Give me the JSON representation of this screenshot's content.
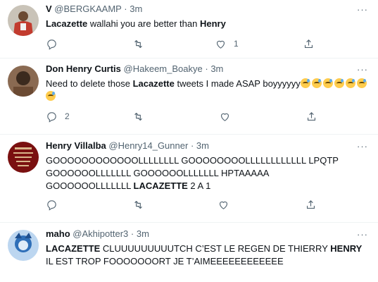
{
  "tweets": [
    {
      "name": "V",
      "handle": "@BERGKAAMP",
      "time": "3m",
      "text_parts": [
        {
          "t": "Lacazette",
          "b": true
        },
        {
          "t": " wallahi you are better than ",
          "b": false
        },
        {
          "t": "Henry",
          "b": true
        }
      ],
      "emoji_count": 0,
      "reply_count": "",
      "retweet_count": "",
      "like_count": "1",
      "avatar_colors": [
        "#7a1b1b",
        "#c23b2e",
        "#e8e2d8"
      ]
    },
    {
      "name": "Don Henry Curtis",
      "handle": "@Hakeem_Boakye",
      "time": "3m",
      "text_parts": [
        {
          "t": "Need to delete those ",
          "b": false
        },
        {
          "t": "Lacazette",
          "b": true
        },
        {
          "t": " tweets I made ASAP boyyyyyy",
          "b": false
        }
      ],
      "emoji_count": 7,
      "reply_count": "2",
      "retweet_count": "",
      "like_count": "",
      "avatar_colors": [
        "#3b2a1e",
        "#6b4a33",
        "#a08066"
      ]
    },
    {
      "name": "Henry Villalba",
      "handle": "@Henry14_Gunner",
      "time": "3m",
      "text_parts": [
        {
          "t": "GOOOOOOOOOOOOLLLLLLLL GOOOOOOOOLLLLLLLLLLLL LPQTP GOOOOOOLLLLLLL GOOOOOOLLLLLLL HPTAAAAA GOOOOOOLLLLLLL ",
          "b": false
        },
        {
          "t": "LACAZETTE",
          "b": true
        },
        {
          "t": " 2 A 1",
          "b": false
        }
      ],
      "emoji_count": 0,
      "reply_count": "",
      "retweet_count": "",
      "like_count": "",
      "avatar_colors": [
        "#5a0c0c",
        "#9a1c1c",
        "#d9b48a"
      ]
    },
    {
      "name": "maho",
      "handle": "@Akhipotter3",
      "time": "3m",
      "text_parts": [
        {
          "t": "LACAZETTE",
          "b": true
        },
        {
          "t": " CLUUUUUUUUUTCH C’EST LE REGEN DE THIERRY ",
          "b": false
        },
        {
          "t": "HENRY",
          "b": true
        },
        {
          "t": " IL EST TROP FOOOOOOORT JE T’AIMEEEEEEEEEEEE",
          "b": false
        }
      ],
      "emoji_count": 0,
      "reply_count": "",
      "retweet_count": "",
      "like_count": "",
      "avatar_colors": [
        "#1e4f8f",
        "#4c8ed6",
        "#e0ecf8"
      ]
    }
  ],
  "more_label": "···"
}
